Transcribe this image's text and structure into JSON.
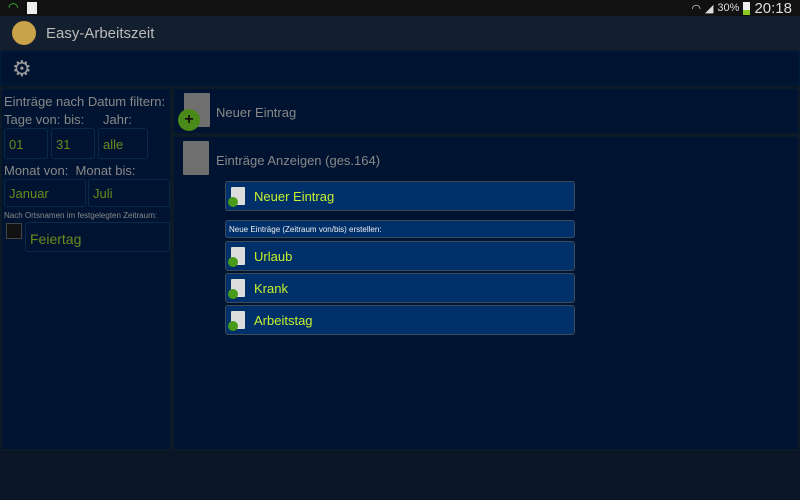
{
  "status": {
    "battery": "30%",
    "time": "20:18"
  },
  "app": {
    "title": "Easy-Arbeitszeit"
  },
  "filter": {
    "heading": "Einträge nach Datum filtern:",
    "days_label": "Tage von: bis:",
    "year_label": "Jahr:",
    "day_from": "01",
    "day_to": "31",
    "year": "alle",
    "month_labels": "Monat von:  Monat bis:",
    "month_from": "Januar",
    "month_to": "Juli",
    "place_label": "Nach Ortsnamen im festgelegten Zeitraum:",
    "place": "Feiertag"
  },
  "main": {
    "new_entry": "Neuer Eintrag",
    "show_entries": "Einträge Anzeigen (ges.164)",
    "btn_new": "Neuer Eintrag",
    "range_label": "Neue Einträge (Zeitraum von/bis) erstellen:",
    "btn_vacation": "Urlaub",
    "btn_sick": "Krank",
    "btn_work": "Arbeitstag"
  }
}
